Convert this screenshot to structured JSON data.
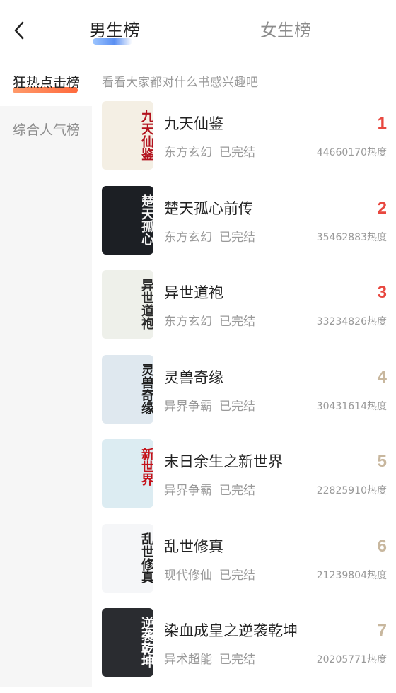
{
  "header": {
    "back_icon": "chevron-left-icon",
    "tabs": [
      {
        "label": "男生榜",
        "active": true
      },
      {
        "label": "女生榜",
        "active": false
      }
    ],
    "accent": "#5a8ff2"
  },
  "sidebar": {
    "items": [
      {
        "label": "狂热点击榜",
        "active": true
      },
      {
        "label": "综合人气榜",
        "active": false
      }
    ],
    "accent": "#ff6a3d"
  },
  "hint": "看看大家都对什么书感兴趣吧",
  "books": [
    {
      "rank": "1",
      "title": "九天仙鉴",
      "genre": "东方玄幻",
      "status": "已完结",
      "heat": "44660170热度",
      "cover_text": "九天仙鉴",
      "cover_bg": "#f4efe4",
      "cover_fg": "#b3121e"
    },
    {
      "rank": "2",
      "title": "楚天孤心前传",
      "genre": "东方玄幻",
      "status": "已完结",
      "heat": "35462883热度",
      "cover_text": "楚天孤心",
      "cover_bg": "#1c1f24",
      "cover_fg": "#f2f2f2"
    },
    {
      "rank": "3",
      "title": "异世道袍",
      "genre": "东方玄幻",
      "status": "已完结",
      "heat": "33234826热度",
      "cover_text": "异世道袍",
      "cover_bg": "#eef0ea",
      "cover_fg": "#2b2b2b"
    },
    {
      "rank": "4",
      "title": "灵兽奇缘",
      "genre": "异界争霸",
      "status": "已完结",
      "heat": "30431614热度",
      "cover_text": "灵兽奇缘",
      "cover_bg": "#dfe8ef",
      "cover_fg": "#1e1e1e"
    },
    {
      "rank": "5",
      "title": "末日余生之新世界",
      "genre": "异界争霸",
      "status": "已完结",
      "heat": "22825910热度",
      "cover_text": "新世界",
      "cover_bg": "#dcecf2",
      "cover_fg": "#c4121a"
    },
    {
      "rank": "6",
      "title": "乱世修真",
      "genre": "现代修仙",
      "status": "已完结",
      "heat": "21239804热度",
      "cover_text": "乱世修真",
      "cover_bg": "#f5f6f8",
      "cover_fg": "#1e1e1e"
    },
    {
      "rank": "7",
      "title": "染血成皇之逆袭乾坤",
      "genre": "异术超能",
      "status": "已完结",
      "heat": "20205771热度",
      "cover_text": "逆袭乾坤",
      "cover_bg": "#2a2c30",
      "cover_fg": "#ffffff"
    }
  ]
}
